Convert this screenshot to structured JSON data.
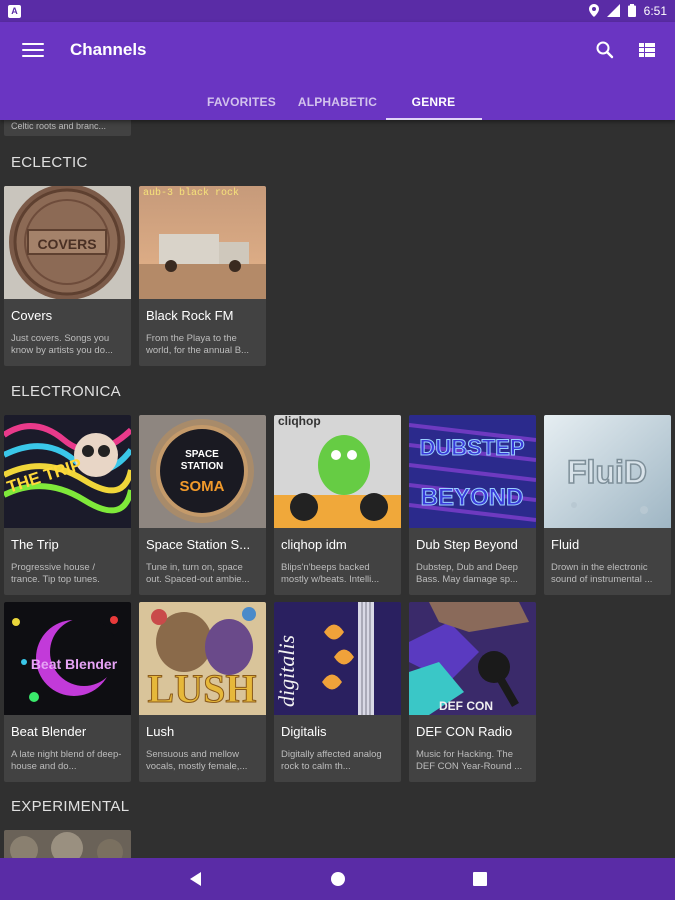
{
  "status": {
    "time": "6:51",
    "app_icon": "A"
  },
  "appbar": {
    "title": "Channels"
  },
  "tabs": [
    {
      "label": "FAVORITES",
      "active": false
    },
    {
      "label": "ALPHABETIC",
      "active": false
    },
    {
      "label": "GENRE",
      "active": true
    }
  ],
  "partial_card": {
    "desc": "Celtic roots and branc..."
  },
  "sections": [
    {
      "title": "ECLECTIC",
      "channels": [
        {
          "name": "Covers",
          "desc": "Just covers. Songs you know by artists you do..."
        },
        {
          "name": "Black Rock FM",
          "desc": "From the Playa to the world, for the annual B...",
          "art_text": "aub-3 black rock"
        }
      ]
    },
    {
      "title": "ELECTRONICA",
      "channels": [
        {
          "name": "The Trip",
          "desc": "Progressive house / trance. Tip top tunes.",
          "art_text": "THE TRIP"
        },
        {
          "name": "Space Station S...",
          "desc": "Tune in, turn on, space out. Spaced-out ambie...",
          "art_text_1": "SPACE",
          "art_text_2": "STATION",
          "art_text_3": "SOMA"
        },
        {
          "name": "cliqhop idm",
          "desc": "Blips'n'beeps backed mostly w/beats. Intelli...",
          "art_text": "cliqhop"
        },
        {
          "name": "Dub Step Beyond",
          "desc": "Dubstep, Dub and Deep Bass. May damage sp...",
          "art_text_1": "DUBSTEP",
          "art_text_2": "BEYOND"
        },
        {
          "name": "Fluid",
          "desc": "Drown in the electronic sound of instrumental ...",
          "art_text": "FluiD"
        },
        {
          "name": "Beat Blender",
          "desc": "A late night blend of deep-house and do...",
          "art_text": "Beat Blender"
        },
        {
          "name": "Lush",
          "desc": "Sensuous and mellow vocals, mostly female,...",
          "art_text": "LUSH"
        },
        {
          "name": "Digitalis",
          "desc": "Digitally affected analog rock to calm th...",
          "art_text": "digitalis"
        },
        {
          "name": "DEF CON Radio",
          "desc": "Music for Hacking. The DEF CON Year-Round ...",
          "art_text": "DEF CON"
        }
      ]
    },
    {
      "title": "EXPERIMENTAL",
      "channels": []
    }
  ],
  "covers_art_text": "COVERS",
  "colors": {
    "primary": "#6a35c2",
    "primary_dark": "#5a2ca6",
    "background": "#303030",
    "card": "#424242"
  }
}
